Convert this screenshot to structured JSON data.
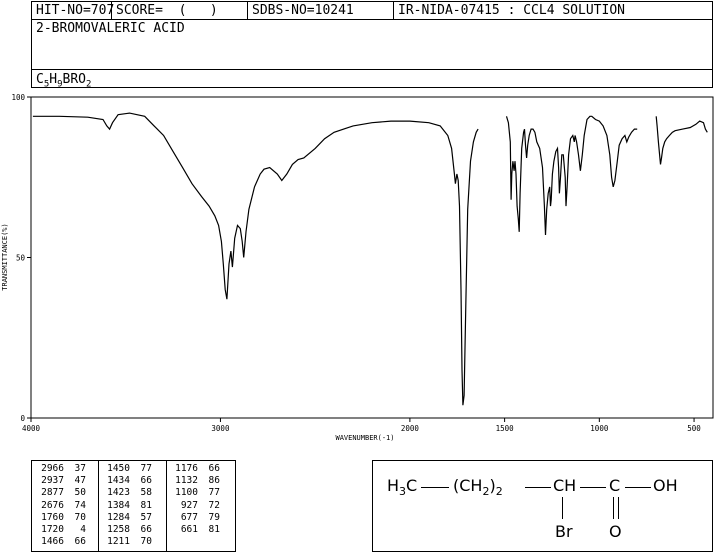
{
  "header": {
    "hit_no": "HIT-NO=707",
    "score": "SCORE=  (   )",
    "sdbs_no": "SDBS-NO=10241",
    "ir_info": "IR-NIDA-07415 : CCL4 SOLUTION",
    "compound_name": "2-BROMOVALERIC ACID",
    "formula": {
      "c": "C",
      "c_n": "5",
      "h": "H",
      "h_n": "9",
      "rest": "BRO",
      "o_n": "2"
    }
  },
  "chart_data": {
    "type": "line",
    "xlabel": "WAVENUMBER(-1)",
    "ylabel": "TRANSMITTANCE(%)",
    "xlim": [
      4000,
      400
    ],
    "ylim": [
      0,
      100
    ],
    "x_ticks": [
      "4000",
      "3000",
      "2000",
      "1500",
      "1000",
      "500"
    ],
    "x_tick_values": [
      4000,
      3000,
      2000,
      1500,
      1000,
      500
    ],
    "y_ticks": [
      "100",
      "50",
      "0"
    ],
    "y_tick_values": [
      100,
      50,
      0
    ],
    "series": [
      {
        "segments": [
          [
            [
              3990,
              94
            ],
            [
              3850,
              94
            ],
            [
              3700,
              93.7
            ],
            [
              3620,
              93
            ],
            [
              3600,
              91
            ],
            [
              3585,
              90
            ],
            [
              3570,
              92
            ],
            [
              3540,
              94.5
            ],
            [
              3480,
              95
            ],
            [
              3400,
              94
            ],
            [
              3350,
              91
            ],
            [
              3300,
              88
            ],
            [
              3250,
              83
            ],
            [
              3200,
              78
            ],
            [
              3150,
              73
            ],
            [
              3100,
              69
            ],
            [
              3060,
              66
            ],
            [
              3030,
              63
            ],
            [
              3010,
              60
            ],
            [
              2995,
              55
            ],
            [
              2985,
              48
            ],
            [
              2975,
              40
            ],
            [
              2966,
              37
            ],
            [
              2955,
              48
            ],
            [
              2945,
              52
            ],
            [
              2937,
              47
            ],
            [
              2925,
              56
            ],
            [
              2910,
              60
            ],
            [
              2895,
              59
            ],
            [
              2885,
              55
            ],
            [
              2877,
              50
            ],
            [
              2865,
              58
            ],
            [
              2850,
              65
            ],
            [
              2820,
              72
            ],
            [
              2790,
              76
            ],
            [
              2770,
              77.5
            ],
            [
              2740,
              78
            ],
            [
              2700,
              76
            ],
            [
              2676,
              74
            ],
            [
              2650,
              76
            ],
            [
              2620,
              79
            ],
            [
              2590,
              80.5
            ],
            [
              2560,
              81
            ],
            [
              2500,
              84
            ],
            [
              2450,
              87
            ],
            [
              2400,
              89
            ],
            [
              2300,
              91
            ],
            [
              2200,
              92
            ],
            [
              2100,
              92.5
            ],
            [
              2000,
              92.5
            ],
            [
              1900,
              92
            ],
            [
              1840,
              91
            ],
            [
              1800,
              88
            ],
            [
              1780,
              84
            ],
            [
              1765,
              76
            ],
            [
              1760,
              73
            ],
            [
              1752,
              76
            ],
            [
              1745,
              74
            ],
            [
              1738,
              66
            ],
            [
              1730,
              40
            ],
            [
              1725,
              15
            ],
            [
              1720,
              4
            ],
            [
              1714,
              7
            ],
            [
              1705,
              35
            ],
            [
              1695,
              65
            ],
            [
              1680,
              80
            ],
            [
              1665,
              86
            ],
            [
              1650,
              89
            ],
            [
              1640,
              90
            ]
          ],
          [
            [
              1490,
              94
            ],
            [
              1480,
              92
            ],
            [
              1470,
              86
            ],
            [
              1466,
              68
            ],
            [
              1462,
              76
            ],
            [
              1456,
              80
            ],
            [
              1450,
              77
            ],
            [
              1445,
              80
            ],
            [
              1440,
              76
            ],
            [
              1434,
              66
            ],
            [
              1428,
              62
            ],
            [
              1423,
              58
            ],
            [
              1418,
              70
            ],
            [
              1410,
              84
            ],
            [
              1400,
              89
            ],
            [
              1395,
              90
            ],
            [
              1390,
              85
            ],
            [
              1384,
              81
            ],
            [
              1378,
              85
            ],
            [
              1370,
              88
            ],
            [
              1360,
              90
            ],
            [
              1350,
              90
            ],
            [
              1340,
              89
            ],
            [
              1330,
              86
            ],
            [
              1315,
              84
            ],
            [
              1300,
              78
            ],
            [
              1290,
              66
            ],
            [
              1284,
              57
            ],
            [
              1278,
              65
            ],
            [
              1270,
              70
            ],
            [
              1262,
              72
            ],
            [
              1258,
              66
            ],
            [
              1254,
              68
            ],
            [
              1248,
              76
            ],
            [
              1240,
              80
            ],
            [
              1230,
              83
            ],
            [
              1221,
              84
            ],
            [
              1215,
              78
            ],
            [
              1211,
              70
            ],
            [
              1205,
              75
            ],
            [
              1198,
              82
            ],
            [
              1190,
              82
            ],
            [
              1180,
              75
            ],
            [
              1176,
              66
            ],
            [
              1170,
              72
            ],
            [
              1162,
              82
            ],
            [
              1152,
              87
            ],
            [
              1140,
              88
            ],
            [
              1132,
              86
            ],
            [
              1128,
              88
            ],
            [
              1120,
              86
            ],
            [
              1110,
              82
            ],
            [
              1100,
              77
            ],
            [
              1090,
              82
            ],
            [
              1080,
              88
            ],
            [
              1065,
              93
            ],
            [
              1050,
              94
            ],
            [
              1040,
              94
            ],
            [
              1020,
              93
            ],
            [
              1000,
              92.5
            ],
            [
              980,
              91
            ],
            [
              960,
              88
            ],
            [
              945,
              82
            ],
            [
              935,
              75
            ],
            [
              927,
              72
            ],
            [
              918,
              74
            ],
            [
              905,
              80
            ],
            [
              895,
              85
            ],
            [
              880,
              87
            ],
            [
              865,
              88
            ],
            [
              855,
              86
            ],
            [
              845,
              87.5
            ],
            [
              830,
              89
            ],
            [
              815,
              90
            ],
            [
              800,
              90
            ]
          ],
          [
            [
              700,
              94
            ],
            [
              695,
              91
            ],
            [
              688,
              86
            ],
            [
              682,
              82
            ],
            [
              677,
              79
            ],
            [
              672,
              81
            ],
            [
              665,
              84
            ],
            [
              655,
              86
            ],
            [
              645,
              87
            ],
            [
              630,
              88
            ],
            [
              615,
              89
            ],
            [
              600,
              89.5
            ],
            [
              560,
              90
            ],
            [
              520,
              90.5
            ],
            [
              490,
              91.5
            ],
            [
              470,
              92.5
            ],
            [
              450,
              92
            ],
            [
              440,
              90
            ],
            [
              430,
              89
            ]
          ]
        ]
      }
    ]
  },
  "peak_table": {
    "columns": [
      [
        [
          "2966",
          "37"
        ],
        [
          "2937",
          "47"
        ],
        [
          "2877",
          "50"
        ],
        [
          "2676",
          "74"
        ],
        [
          "1760",
          "70"
        ],
        [
          "1720",
          "4"
        ],
        [
          "1466",
          "66"
        ]
      ],
      [
        [
          "1450",
          "77"
        ],
        [
          "1434",
          "66"
        ],
        [
          "1423",
          "58"
        ],
        [
          "1384",
          "81"
        ],
        [
          "1284",
          "57"
        ],
        [
          "1258",
          "66"
        ],
        [
          "1211",
          "70"
        ]
      ],
      [
        [
          "1176",
          "66"
        ],
        [
          "1132",
          "86"
        ],
        [
          "1100",
          "77"
        ],
        [
          "927",
          "72"
        ],
        [
          "677",
          "79"
        ],
        [
          "661",
          "81"
        ]
      ]
    ]
  },
  "structure": {
    "h3c": "H",
    "h3c_sub": "3",
    "h3c_c": "C",
    "ch2_open": "(CH",
    "ch2_sub": "2",
    "ch2_close": ")",
    "ch2_n": "2",
    "ch": "CH",
    "c": "C",
    "oh": "OH",
    "br": "Br",
    "o": "O"
  }
}
